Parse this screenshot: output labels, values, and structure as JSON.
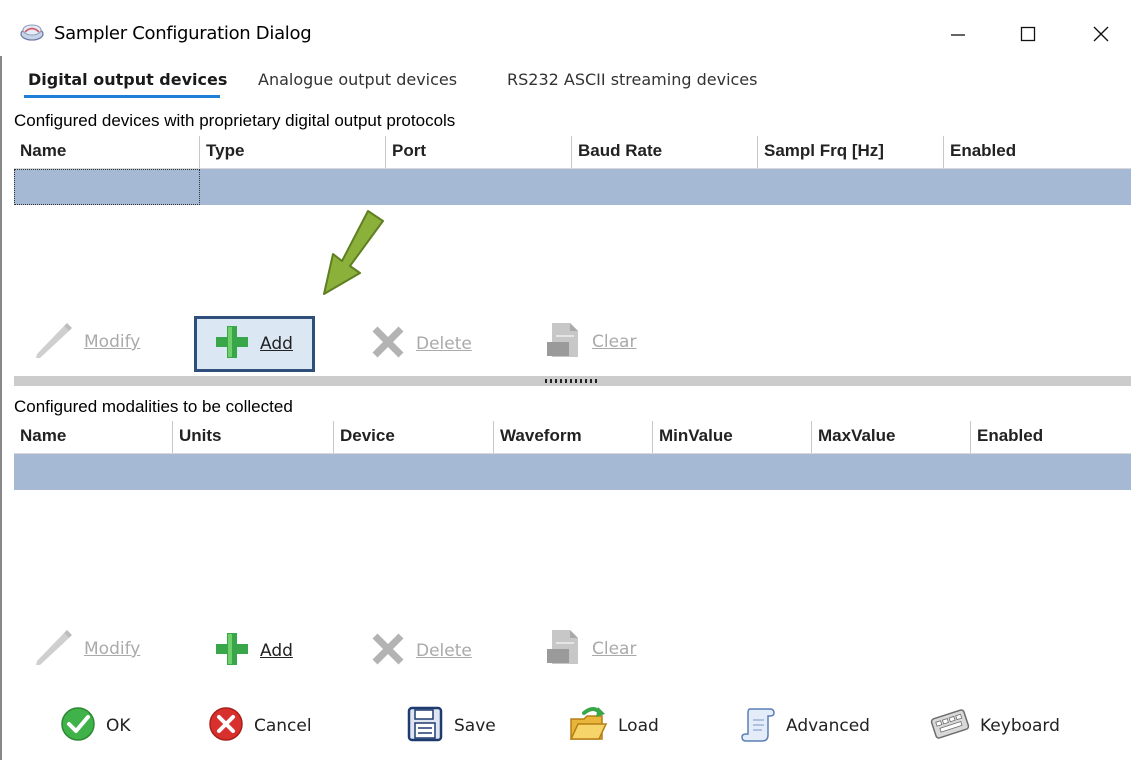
{
  "window": {
    "title": "Sampler Configuration Dialog",
    "minimize_glyph": "—",
    "maximize_glyph": "☐",
    "close_glyph": "✕"
  },
  "tabs": [
    {
      "label": "Digital output devices",
      "active": true
    },
    {
      "label": "Analogue output devices",
      "active": false
    },
    {
      "label": "RS232 ASCII streaming devices",
      "active": false
    }
  ],
  "devices_section": {
    "title": "Configured devices with proprietary digital output protocols",
    "columns": [
      "Name",
      "Type",
      "Port",
      "Baud Rate",
      "Sampl Frq [Hz]",
      "Enabled"
    ],
    "toolbar": {
      "modify": {
        "label": "Modify",
        "enabled": false,
        "icon": "pencil-icon"
      },
      "add": {
        "label": "Add",
        "enabled": true,
        "icon": "plus-icon"
      },
      "delete": {
        "label": "Delete",
        "enabled": false,
        "icon": "x-icon"
      },
      "clear": {
        "label": "Clear",
        "enabled": false,
        "icon": "document-icon"
      }
    }
  },
  "modalities_section": {
    "title": "Configured modalities to be collected",
    "columns": [
      "Name",
      "Units",
      "Device",
      "Waveform",
      "MinValue",
      "MaxValue",
      "Enabled"
    ],
    "toolbar": {
      "modify": {
        "label": "Modify",
        "enabled": false,
        "icon": "pencil-icon"
      },
      "add": {
        "label": "Add",
        "enabled": true,
        "icon": "plus-icon"
      },
      "delete": {
        "label": "Delete",
        "enabled": false,
        "icon": "x-icon"
      },
      "clear": {
        "label": "Clear",
        "enabled": false,
        "icon": "document-icon"
      }
    }
  },
  "footer": {
    "ok": {
      "label": "OK",
      "icon": "check-icon"
    },
    "cancel": {
      "label": "Cancel",
      "icon": "cancel-icon"
    },
    "save": {
      "label": "Save",
      "icon": "floppy-icon"
    },
    "load": {
      "label": "Load",
      "icon": "folder-icon"
    },
    "advanced": {
      "label": "Advanced",
      "icon": "scroll-icon"
    },
    "keyboard": {
      "label": "Keyboard",
      "icon": "keyboard-icon"
    }
  },
  "colors": {
    "selected_row": "#a5b9d5",
    "tab_underline": "#1f7fd6",
    "add_highlight_border": "#2e4f7a",
    "annotation_arrow": "#8bb13a",
    "splitter": "#cccccc"
  }
}
